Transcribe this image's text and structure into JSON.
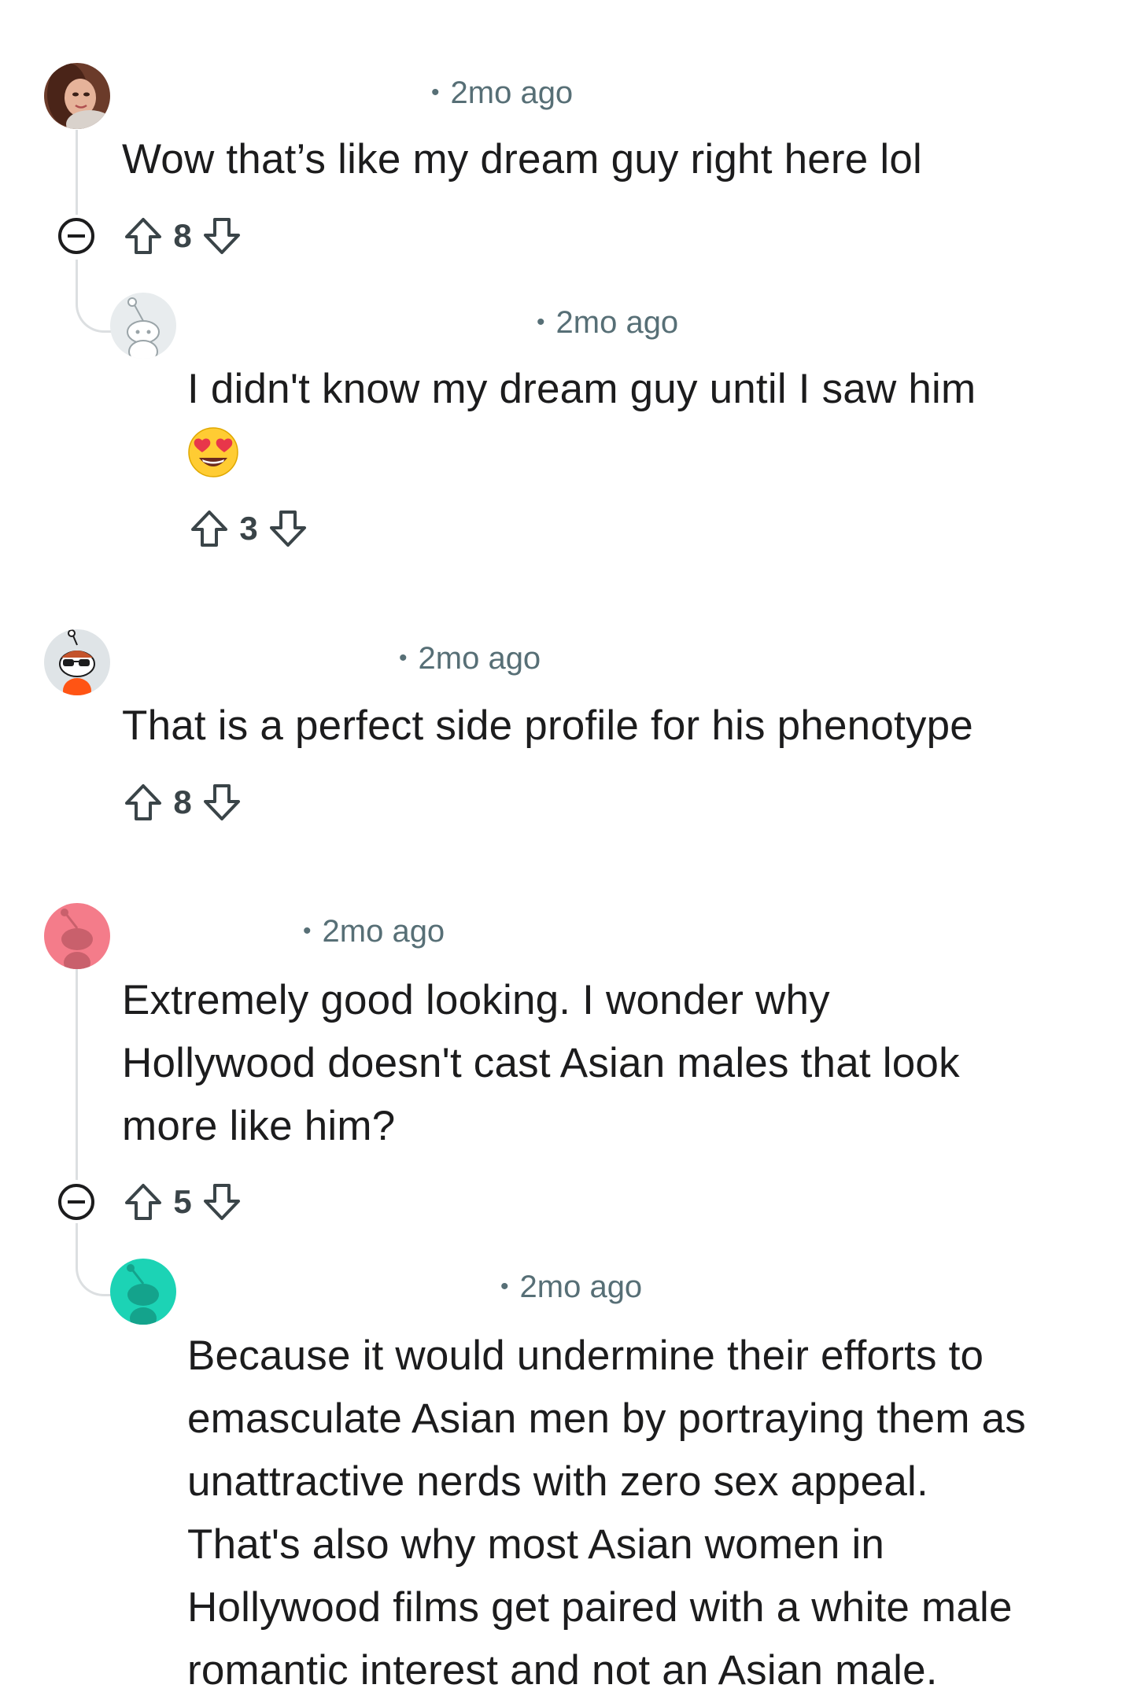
{
  "comments": [
    {
      "time": "2mo ago",
      "text": "Wow that’s like my dream guy right here lol",
      "votes": "8",
      "avatar": "photo-avatar"
    },
    {
      "time": "2mo ago",
      "text": "I didn't know my dream guy until I saw him",
      "votes": "3",
      "avatar": "snoo-white-avatar",
      "emoji": "heart-eyes-emoji"
    },
    {
      "time": "2mo ago",
      "text": "That is a perfect side profile for his phenotype",
      "votes": "8",
      "avatar": "snoo-sunglasses-avatar"
    },
    {
      "time": "2mo ago",
      "lines": [
        "Extremely good looking. I wonder why",
        "Hollywood doesn't cast Asian males that look",
        "more like him?"
      ],
      "votes": "5",
      "avatar": "snoo-pink-avatar"
    },
    {
      "time": "2mo ago",
      "lines": [
        "Because it would undermine their efforts to",
        "emasculate Asian men by portraying them as",
        "unattractive nerds with zero sex appeal.",
        "That's also why most Asian women in",
        "Hollywood films get paired with a white male",
        "romantic interest and not an Asian male."
      ],
      "avatar": "snoo-teal-avatar"
    }
  ],
  "icons": {
    "upvote": "upvote-arrow-icon",
    "downvote": "downvote-arrow-icon",
    "collapse": "collapse-minus-icon",
    "separator": "•"
  },
  "colors": {
    "meta": "#576f76",
    "text": "#1c1c1d",
    "thread": "#dcdfe1",
    "pink_avatar": "#f47c8a",
    "teal_avatar": "#1cd3b5"
  }
}
